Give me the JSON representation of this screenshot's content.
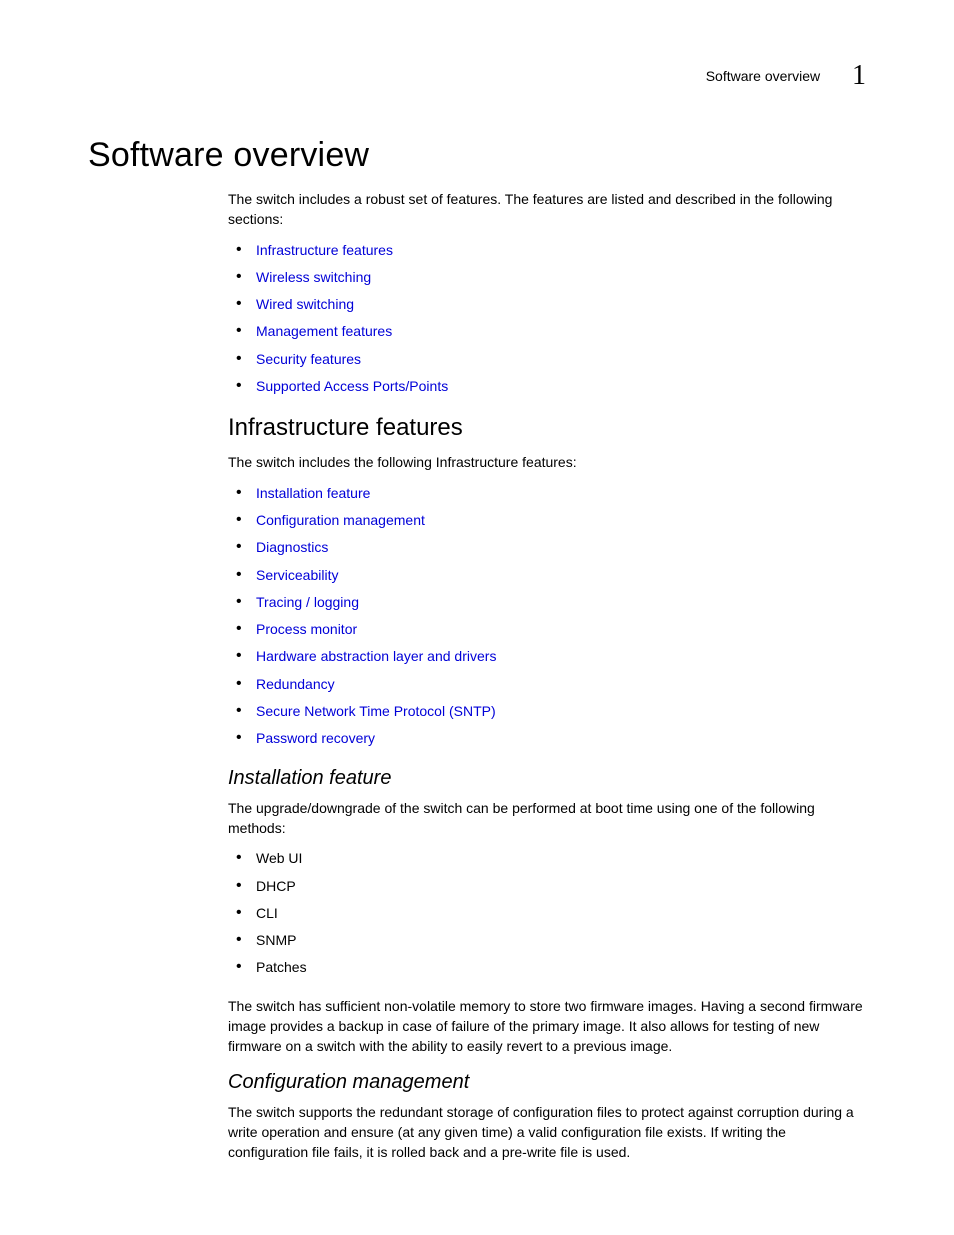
{
  "header": {
    "title": "Software overview",
    "chapter_num": "1"
  },
  "h1": "Software overview",
  "intro": "The switch includes a robust set of features. The features are listed and described in the following sections:",
  "top_links": [
    "Infrastructure features",
    "Wireless switching",
    "Wired switching",
    "Management features",
    "Security features",
    "Supported Access Ports/Points"
  ],
  "section1": {
    "heading": "Infrastructure features",
    "intro": "The switch includes the following Infrastructure features:",
    "links": [
      "Installation feature",
      "Configuration management",
      "Diagnostics",
      "Serviceability",
      "Tracing / logging",
      "Process monitor",
      "Hardware abstraction layer and drivers",
      "Redundancy",
      "Secure Network Time Protocol (SNTP)",
      "Password recovery"
    ]
  },
  "install": {
    "heading": "Installation feature",
    "p1": "The upgrade/downgrade of the switch can be performed at boot time using one of the following methods:",
    "items": [
      "Web UI",
      "DHCP",
      "CLI",
      "SNMP",
      "Patches"
    ],
    "p2": "The switch has sufficient non-volatile memory to store two firmware images. Having a second firmware image provides a backup in case of failure of the primary image. It also allows for testing of new firmware on a switch with the ability to easily revert to a previous image."
  },
  "config": {
    "heading": "Configuration management",
    "p1": "The switch supports the redundant storage of configuration files to protect against corruption during a write operation and ensure (at any given time) a valid configuration file exists. If writing the configuration file fails, it is rolled back and a pre-write file is used."
  }
}
